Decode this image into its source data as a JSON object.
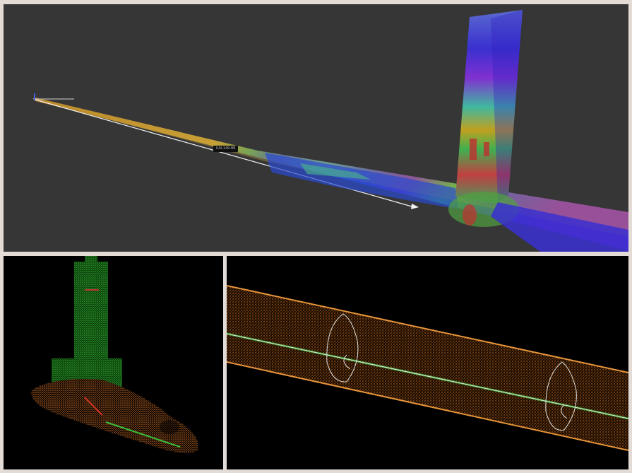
{
  "views": {
    "main": {
      "label": "main-3d-view",
      "tag_text": "ILN-149.88"
    },
    "bottom_left": {
      "label": "junction-point-cloud-view"
    },
    "bottom_right": {
      "label": "pipe-section-point-cloud-view"
    }
  },
  "colors": {
    "background_frame": "#e3dcd6",
    "viewport_bg": "#363636",
    "cloud_bg": "#000000",
    "pipe_orange": "#d07a2a",
    "pipe_green": "#3cb83c",
    "pipe_blue": "#2a3cc8",
    "pipe_purple": "#7a2ad8"
  }
}
